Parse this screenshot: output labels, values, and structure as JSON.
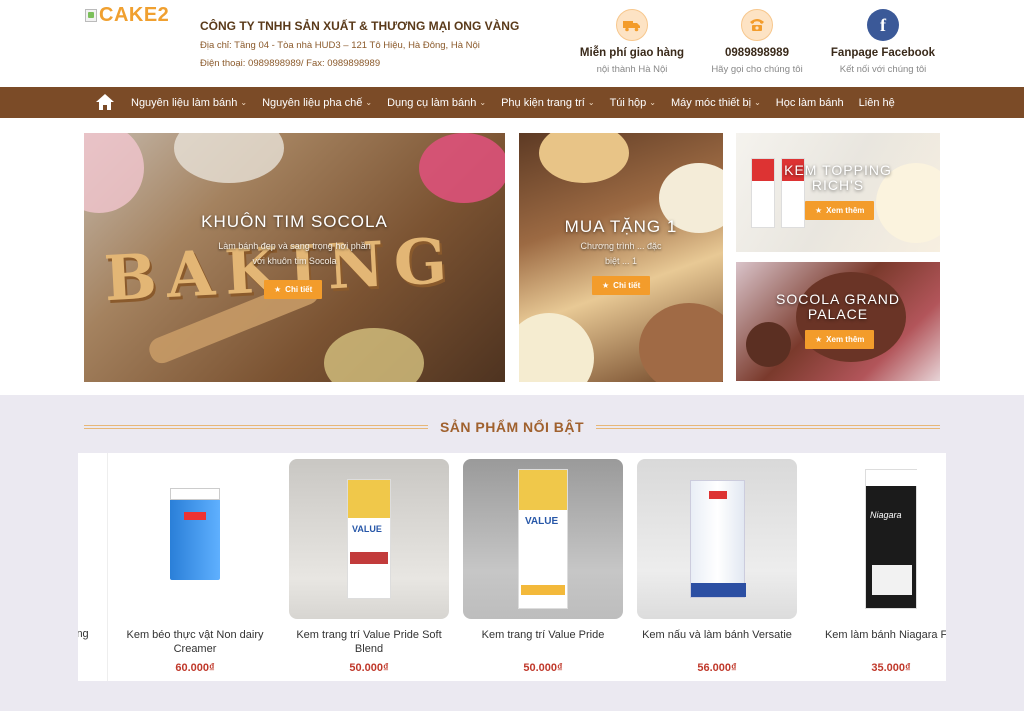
{
  "header": {
    "logo_text": "CAKE2",
    "company_name": "CÔNG TY TNHH SẢN XUẤT & THƯƠNG MẠI ONG VÀNG",
    "address": "Địa chỉ: Tầng 04 - Tòa nhà HUD3 – 121 Tô Hiệu, Hà Đông, Hà Nội",
    "phone_fax": "Điện thoại: 0989898989/ Fax: 0989898989",
    "boxes": [
      {
        "title": "Miễn phí giao hàng",
        "sub": "nội thành Hà Nội",
        "icon": "truck-icon"
      },
      {
        "title": "0989898989",
        "sub": "Hãy gọi cho chúng tôi",
        "icon": "phone-icon"
      },
      {
        "title": "Fanpage Facebook",
        "sub": "Kết nối với chúng tôi",
        "icon": "facebook-icon"
      }
    ]
  },
  "nav": {
    "items": [
      {
        "label": "Nguyên liệu làm bánh",
        "has_dropdown": true
      },
      {
        "label": "Nguyên liệu pha chế",
        "has_dropdown": true
      },
      {
        "label": "Dụng cụ làm bánh",
        "has_dropdown": true
      },
      {
        "label": "Phụ kiện trang trí",
        "has_dropdown": true
      },
      {
        "label": "Túi hộp",
        "has_dropdown": true
      },
      {
        "label": "Máy móc thiết bị",
        "has_dropdown": true
      },
      {
        "label": "Học làm bánh",
        "has_dropdown": false
      },
      {
        "label": "Liên hệ",
        "has_dropdown": false
      }
    ]
  },
  "banners": {
    "main": {
      "image_text": "BAKING",
      "title": "KHUÔN TIM SOCOLA",
      "line1": "Làm bánh đẹp và sang trọng hơi phần",
      "line2": "với khuôn tim Socola",
      "button": "Chi tiết"
    },
    "middle": {
      "title": "MUA TẶNG 1",
      "line1": "Chương trình ... đặc",
      "line2": "biệt ... 1",
      "button": "Chi tiết"
    },
    "top_right": {
      "title_line1": "KEM TOPPING",
      "title_line2": "RICH'S",
      "button": "Xem thêm"
    },
    "bottom_right": {
      "title_line1": "SOCOLA GRAND",
      "title_line2": "PALACE",
      "button": "Xem thêm"
    }
  },
  "featured": {
    "title": "SẢN PHẨM NỔI BẬT",
    "partial_left_label": "ing",
    "products": [
      {
        "name_line1": "Kem béo thực vật Non dairy",
        "name_line2": "Creamer",
        "price": "60.000₫"
      },
      {
        "name_line1": "Kem trang trí Value Pride Soft",
        "name_line2": "Blend",
        "price": "50.000₫"
      },
      {
        "name_line1": "Kem trang trí Value Pride",
        "name_line2": "",
        "price": "50.000₫"
      },
      {
        "name_line1": "Kem nấu và làm bánh Versatie",
        "name_line2": "",
        "price": "56.000₫"
      },
      {
        "name_line1": "Kem làm bánh Niagara Far",
        "name_line2": "",
        "price": "35.000₫"
      }
    ]
  },
  "colors": {
    "nav_bg": "#7b4b27",
    "accent_orange": "#f39c2b",
    "price_red": "#c0392b",
    "section_bg": "#ebe9f1"
  }
}
